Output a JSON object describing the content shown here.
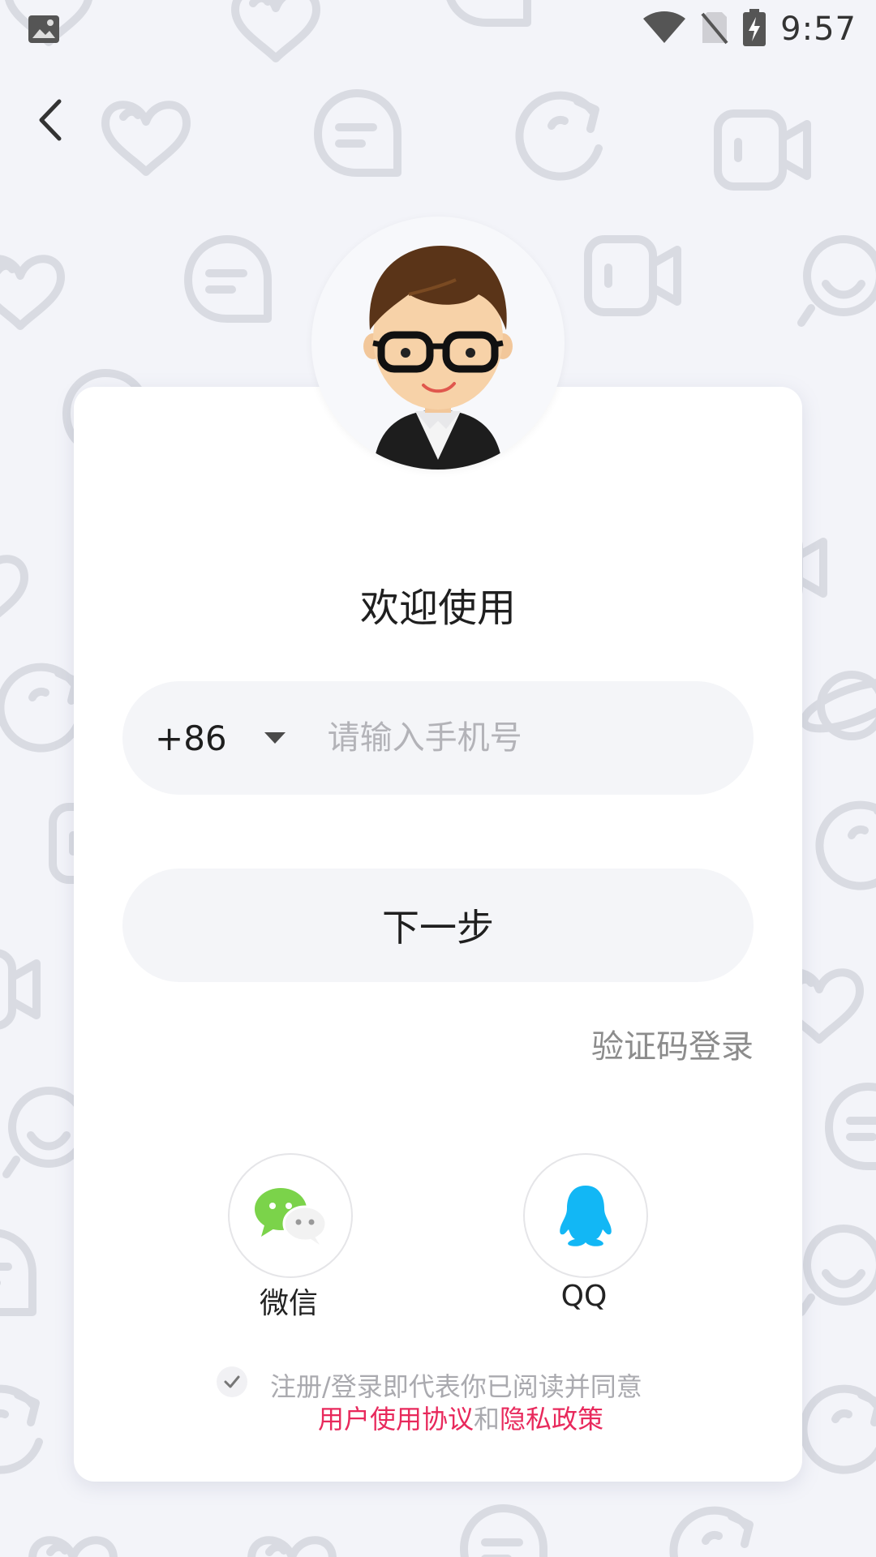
{
  "status_bar": {
    "time": "9:57",
    "left_icon": "gallery-icon",
    "icons": [
      "wifi-icon",
      "no-sim-icon",
      "battery-charging-icon"
    ]
  },
  "nav": {
    "back_icon": "back-arrow-icon"
  },
  "header": {
    "avatar": "cartoon-avatar-with-glasses",
    "title": "欢迎使用"
  },
  "phone": {
    "country_code": "+86",
    "placeholder": "请输入手机号",
    "value": ""
  },
  "actions": {
    "next_label": "下一步",
    "sms_login_label": "验证码登录"
  },
  "social": [
    {
      "name": "微信",
      "icon": "wechat-icon",
      "color": "#7bd34a"
    },
    {
      "name": "QQ",
      "icon": "qq-penguin-icon",
      "color": "#12b7f5"
    }
  ],
  "agreement": {
    "checked": true,
    "prefix": "注册/登录即代表你已阅读并同意",
    "terms_label": "用户使用协议",
    "conjunction": "和",
    "privacy_label": "隐私政策",
    "link_color": "#e8295c"
  },
  "background": {
    "pattern_icons": [
      "heart-icon",
      "chat-bubble-icon",
      "refresh-icon",
      "video-camera-icon",
      "smile-icon",
      "planet-icon"
    ]
  }
}
